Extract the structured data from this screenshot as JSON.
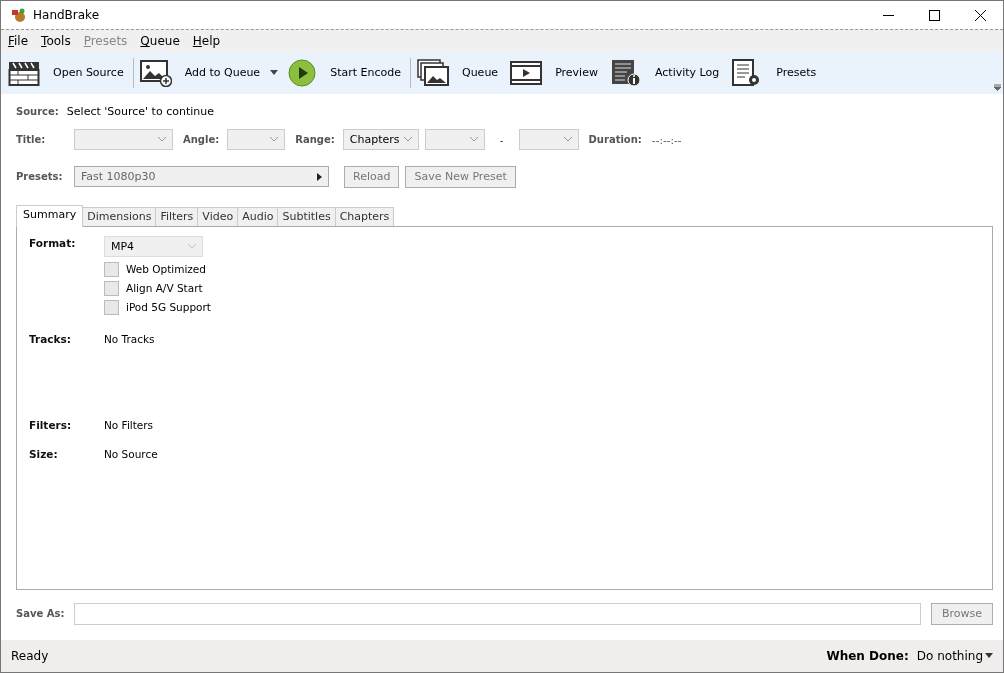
{
  "window": {
    "title": "HandBrake"
  },
  "menu": [
    {
      "label": "File",
      "disabled": false
    },
    {
      "label": "Tools",
      "disabled": false
    },
    {
      "label": "Presets",
      "disabled": true
    },
    {
      "label": "Queue",
      "disabled": false
    },
    {
      "label": "Help",
      "disabled": false
    }
  ],
  "toolbar": [
    {
      "label": "Open Source",
      "dropdown": false
    },
    {
      "label": "Add to Queue",
      "dropdown": true
    },
    {
      "label": "Start Encode",
      "dropdown": false
    },
    {
      "label": "Queue",
      "dropdown": false
    },
    {
      "label": "Preview",
      "dropdown": false
    },
    {
      "label": "Activity Log",
      "dropdown": false
    },
    {
      "label": "Presets",
      "dropdown": false
    }
  ],
  "source": {
    "label": "Source:",
    "value": "Select 'Source' to continue"
  },
  "title_row": {
    "title_label": "Title:",
    "angle_label": "Angle:",
    "range_label": "Range:",
    "range_value": "Chapters",
    "range_dash": "-",
    "duration_label": "Duration:",
    "duration_value": "--:--:--"
  },
  "presets": {
    "label": "Presets:",
    "value": "Fast 1080p30",
    "buttons": [
      {
        "label": "Reload",
        "disabled": true
      },
      {
        "label": "Save New Preset",
        "disabled": true
      }
    ]
  },
  "tabs": [
    {
      "label": "Summary",
      "selected": true
    },
    {
      "label": "Dimensions",
      "selected": false
    },
    {
      "label": "Filters",
      "selected": false
    },
    {
      "label": "Video",
      "selected": false
    },
    {
      "label": "Audio",
      "selected": false
    },
    {
      "label": "Subtitles",
      "selected": false
    },
    {
      "label": "Chapters",
      "selected": false
    }
  ],
  "summary": {
    "format_label": "Format:",
    "format_value": "MP4",
    "options": [
      {
        "label": "Web Optimized",
        "checked": false
      },
      {
        "label": "Align A/V Start",
        "checked": false
      },
      {
        "label": "iPod 5G Support",
        "checked": false
      }
    ],
    "rows": [
      {
        "label": "Tracks:",
        "value": "No Tracks"
      },
      {
        "label": "Filters:",
        "value": "No Filters"
      },
      {
        "label": "Size:",
        "value": "No Source"
      }
    ]
  },
  "save_as": {
    "label": "Save As:",
    "button": "Browse"
  },
  "status_bar": {
    "status": "Ready",
    "when_done_label": "When Done:",
    "when_done_value": "Do nothing"
  }
}
